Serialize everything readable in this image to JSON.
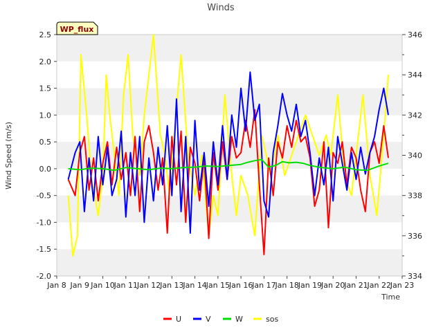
{
  "chart_data": {
    "type": "line",
    "title": "Winds",
    "xlabel": "Time",
    "ylabel": "Wind Speed (m/s)",
    "badge": "WP_flux",
    "x_tick_labels": [
      "Jan 8",
      "Jan 9",
      "Jan 10",
      "Jan 11",
      "Jan 12",
      "Jan 13",
      "Jan 14",
      "Jan 15",
      "Jan 16",
      "Jan 17",
      "Jan 18",
      "Jan 19",
      "Jan 20",
      "Jan 21",
      "Jan 22",
      "Jan 23"
    ],
    "xlim": [
      8,
      23
    ],
    "ylim": [
      -2.0,
      2.5
    ],
    "y_tick_labels": [
      "-2.0",
      "-1.5",
      "-1.0",
      "-0.5",
      "0.0",
      "0.5",
      "1.0",
      "1.5",
      "2.0",
      "2.5"
    ],
    "y2lim": [
      334,
      346
    ],
    "y2_tick_labels": [
      "334",
      "336",
      "338",
      "340",
      "342",
      "344",
      "346"
    ],
    "grid": "horizontal bands",
    "legend_position": "bottom",
    "series": [
      {
        "name": "U",
        "axis": "left",
        "color": "#ff0000",
        "x": [
          8.5,
          8.8,
          9.0,
          9.2,
          9.4,
          9.6,
          9.8,
          10.0,
          10.2,
          10.4,
          10.6,
          10.8,
          11.0,
          11.2,
          11.4,
          11.6,
          11.8,
          12.0,
          12.2,
          12.4,
          12.6,
          12.8,
          13.0,
          13.2,
          13.4,
          13.6,
          13.8,
          14.0,
          14.2,
          14.4,
          14.6,
          14.8,
          15.0,
          15.2,
          15.4,
          15.6,
          15.8,
          16.0,
          16.2,
          16.4,
          16.6,
          16.8,
          17.0,
          17.2,
          17.4,
          17.6,
          17.8,
          18.0,
          18.2,
          18.4,
          18.6,
          18.8,
          19.0,
          19.2,
          19.4,
          19.6,
          19.8,
          20.0,
          20.2,
          20.4,
          20.6,
          20.8,
          21.0,
          21.2,
          21.4,
          21.6,
          21.8,
          22.0,
          22.2,
          22.4
        ],
        "values": [
          -0.2,
          -0.5,
          0.3,
          0.6,
          -0.4,
          0.2,
          -0.6,
          0.1,
          0.5,
          -0.3,
          0.4,
          -0.2,
          0.3,
          -0.5,
          0.6,
          -0.8,
          0.5,
          0.8,
          0.3,
          -0.4,
          0.2,
          -1.2,
          0.6,
          -0.3,
          0.7,
          -1.0,
          0.4,
          0.1,
          -0.6,
          0.2,
          -1.3,
          0.3,
          -0.4,
          0.5,
          -0.2,
          0.6,
          0.2,
          0.3,
          0.9,
          0.4,
          1.1,
          -0.3,
          -1.6,
          0.2,
          -0.5,
          0.5,
          0.2,
          0.8,
          0.4,
          0.9,
          0.5,
          0.6,
          0.2,
          -0.7,
          -0.4,
          0.5,
          -1.1,
          0.3,
          0.1,
          0.5,
          -0.3,
          0.4,
          0.2,
          -0.4,
          -0.8,
          0.3,
          0.5,
          0.1,
          0.8,
          0.2
        ]
      },
      {
        "name": "V",
        "axis": "left",
        "color": "#0000ff",
        "x": [
          8.5,
          8.8,
          9.0,
          9.2,
          9.4,
          9.6,
          9.8,
          10.0,
          10.2,
          10.4,
          10.6,
          10.8,
          11.0,
          11.2,
          11.4,
          11.6,
          11.8,
          12.0,
          12.2,
          12.4,
          12.6,
          12.8,
          13.0,
          13.2,
          13.4,
          13.6,
          13.8,
          14.0,
          14.2,
          14.4,
          14.6,
          14.8,
          15.0,
          15.2,
          15.4,
          15.6,
          15.8,
          16.0,
          16.2,
          16.4,
          16.6,
          16.8,
          17.0,
          17.2,
          17.4,
          17.6,
          17.8,
          18.0,
          18.2,
          18.4,
          18.6,
          18.8,
          19.0,
          19.2,
          19.4,
          19.6,
          19.8,
          20.0,
          20.2,
          20.4,
          20.6,
          20.8,
          21.0,
          21.2,
          21.4,
          21.6,
          21.8,
          22.0,
          22.2,
          22.4
        ],
        "values": [
          -0.2,
          0.3,
          0.5,
          -0.8,
          0.2,
          -0.6,
          0.6,
          -0.3,
          0.4,
          -0.5,
          -0.2,
          0.7,
          -0.9,
          0.3,
          -0.5,
          0.6,
          -1.0,
          0.2,
          -0.6,
          0.4,
          -0.3,
          0.8,
          -0.5,
          1.3,
          -0.8,
          0.6,
          -1.2,
          0.9,
          -0.4,
          0.3,
          -0.7,
          0.5,
          -0.3,
          0.8,
          -0.2,
          1.0,
          0.4,
          1.5,
          0.7,
          1.8,
          0.9,
          1.2,
          -0.6,
          -0.9,
          0.3,
          0.8,
          1.4,
          1.0,
          0.7,
          1.2,
          0.6,
          0.9,
          0.3,
          -0.5,
          0.2,
          -0.3,
          0.4,
          -0.6,
          0.6,
          0.1,
          -0.4,
          0.3,
          -0.2,
          0.4,
          -0.1,
          0.3,
          0.6,
          1.1,
          1.5,
          1.0
        ]
      },
      {
        "name": "W",
        "axis": "left",
        "color": "#00dd00",
        "x": [
          8.5,
          9.0,
          9.5,
          10.0,
          10.5,
          11.0,
          11.5,
          12.0,
          12.5,
          13.0,
          13.5,
          14.0,
          14.5,
          15.0,
          15.5,
          16.0,
          16.3,
          16.6,
          16.9,
          17.2,
          17.5,
          17.8,
          18.1,
          18.4,
          18.7,
          19.0,
          19.5,
          20.0,
          20.5,
          21.0,
          21.5,
          22.0,
          22.4
        ],
        "values": [
          0.0,
          -0.02,
          0.01,
          0.0,
          -0.03,
          0.02,
          0.0,
          -0.02,
          0.01,
          0.0,
          0.02,
          0.03,
          0.05,
          0.04,
          0.06,
          0.08,
          0.12,
          0.15,
          0.17,
          0.03,
          0.06,
          0.13,
          0.11,
          0.12,
          0.1,
          0.06,
          0.02,
          0.0,
          0.03,
          -0.02,
          -0.03,
          0.05,
          0.1
        ]
      },
      {
        "name": "sos",
        "axis": "right",
        "color": "#ffff00",
        "x": [
          8.5,
          8.7,
          8.9,
          9.05,
          9.3,
          9.5,
          9.8,
          10.0,
          10.15,
          10.3,
          10.5,
          10.7,
          10.9,
          11.1,
          11.3,
          11.6,
          11.8,
          12.0,
          12.2,
          12.5,
          12.7,
          12.9,
          13.1,
          13.4,
          13.7,
          14.0,
          14.3,
          14.6,
          14.8,
          15.0,
          15.3,
          15.6,
          15.8,
          16.0,
          16.3,
          16.6,
          16.9,
          17.1,
          17.3,
          17.6,
          17.9,
          18.2,
          18.5,
          18.8,
          19.1,
          19.4,
          19.7,
          19.9,
          20.2,
          20.5,
          20.8,
          21.0,
          21.3,
          21.6,
          21.9,
          22.2,
          22.4
        ],
        "values": [
          338,
          335,
          336,
          345,
          342,
          339,
          337,
          339,
          344,
          342,
          340,
          338,
          343,
          345,
          341,
          339,
          342,
          344,
          346,
          341,
          340,
          338,
          341,
          345,
          340,
          338,
          340,
          336,
          338,
          337,
          343,
          339,
          337,
          339,
          338,
          336,
          341,
          340,
          339,
          341,
          339,
          340,
          341,
          342,
          341,
          340,
          341,
          340,
          343,
          339,
          338,
          340,
          343,
          339,
          337,
          341,
          344
        ]
      }
    ]
  }
}
